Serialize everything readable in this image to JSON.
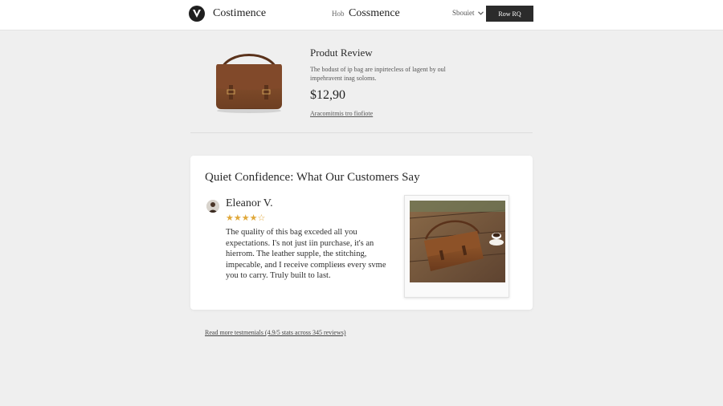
{
  "header": {
    "brand": "Costimence",
    "nav_small": "Hob",
    "nav_brand": "Cossmence",
    "dropdown_label": "Sbouiet",
    "cta_label": "Row RQ"
  },
  "product": {
    "title": "Produt Review",
    "description": "The bodust of ip bag are inpirtecless of lagent by oul impehravent inag soloms.",
    "price": "$12,90",
    "link": "Aracomitmis tro fiofiote"
  },
  "testimonials": {
    "title": "Quiet Confidence: What Our Customers Say",
    "reviewer": "Eleanor V.",
    "stars": "★★★★☆",
    "rating": 4.5,
    "review": "The quality of this bag exceded all you expectations. I's not just iin purchase, it's an hierrom. The leather supple, the stitching, impecable, and I receive complieиs every svme you to carry. Truly built to last.",
    "more_link": "Read more testmenials (4.9/5 stats across 345 reviews)"
  },
  "icons": {
    "logo": "logo-v-icon",
    "dropdown": "chevron-down-icon",
    "avatar": "avatar-icon"
  },
  "colors": {
    "accent_dark": "#2b2b2b",
    "star": "#e0a83a",
    "background": "#efefef"
  }
}
